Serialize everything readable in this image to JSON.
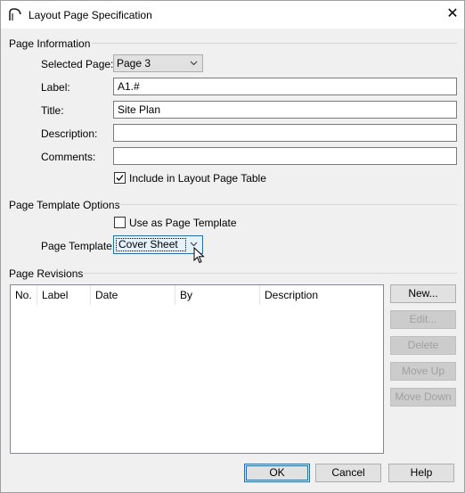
{
  "window": {
    "title": "Layout Page Specification",
    "close_glyph": "✕"
  },
  "page_info": {
    "group_label": "Page Information",
    "selected_page_label": "Selected Page:",
    "selected_page_value": "Page 3",
    "label_label": "Label:",
    "label_value": "A1.#",
    "title_label": "Title:",
    "title_value": "Site Plan",
    "description_label": "Description:",
    "description_value": "",
    "comments_label": "Comments:",
    "comments_value": "",
    "include_table_label": "Include in Layout Page Table",
    "include_table_checked": true
  },
  "template_options": {
    "group_label": "Page Template Options",
    "use_as_template_label": "Use as Page Template",
    "use_as_template_checked": false,
    "page_template_label": "Page Template:",
    "page_template_value": "Cover Sheet"
  },
  "revisions": {
    "group_label": "Page Revisions",
    "columns": [
      "No.",
      "Label",
      "Date",
      "By",
      "Description"
    ],
    "rows": [],
    "buttons": {
      "new": "New...",
      "edit": "Edit...",
      "delete": "Delete",
      "move_up": "Move Up",
      "move_down": "Move Down"
    }
  },
  "footer": {
    "ok": "OK",
    "cancel": "Cancel",
    "help": "Help"
  },
  "colors": {
    "accent": "#0078d7",
    "disabled_text": "#a0a0a0"
  }
}
